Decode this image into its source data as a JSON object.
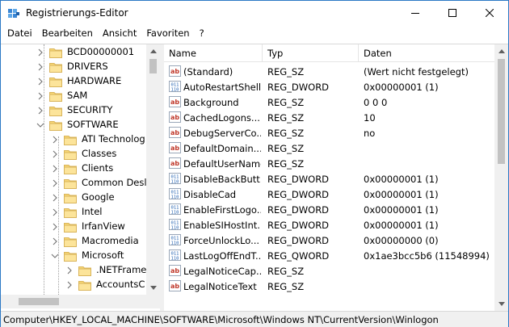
{
  "window": {
    "title": "Registrierungs-Editor",
    "accent": "#2b78c5"
  },
  "menu": [
    {
      "label": "Datei"
    },
    {
      "label": "Bearbeiten"
    },
    {
      "label": "Ansicht"
    },
    {
      "label": "Favoriten"
    },
    {
      "label": "?"
    }
  ],
  "tree": {
    "items": [
      {
        "label": "BCD00000001",
        "level": 1,
        "expanded": false
      },
      {
        "label": "DRIVERS",
        "level": 1,
        "expanded": false
      },
      {
        "label": "HARDWARE",
        "level": 1,
        "expanded": false
      },
      {
        "label": "SAM",
        "level": 1,
        "expanded": false
      },
      {
        "label": "SECURITY",
        "level": 1,
        "expanded": false
      },
      {
        "label": "SOFTWARE",
        "level": 1,
        "expanded": true
      },
      {
        "label": "ATI Technolog",
        "level": 2,
        "expanded": false
      },
      {
        "label": "Classes",
        "level": 2,
        "expanded": false
      },
      {
        "label": "Clients",
        "level": 2,
        "expanded": false
      },
      {
        "label": "Common Desl",
        "level": 2,
        "expanded": false
      },
      {
        "label": "Google",
        "level": 2,
        "expanded": false
      },
      {
        "label": "Intel",
        "level": 2,
        "expanded": false
      },
      {
        "label": "IrfanView",
        "level": 2,
        "expanded": false
      },
      {
        "label": "Macromedia",
        "level": 2,
        "expanded": false
      },
      {
        "label": "Microsoft",
        "level": 2,
        "expanded": true
      },
      {
        "label": ".NETFrame",
        "level": 3,
        "expanded": false
      },
      {
        "label": "AccountsC",
        "level": 3,
        "expanded": false
      }
    ]
  },
  "list": {
    "columns": {
      "name": "Name",
      "type": "Typ",
      "data": "Daten"
    },
    "rows": [
      {
        "icon": "string",
        "name": "(Standard)",
        "type": "REG_SZ",
        "data": "(Wert nicht festgelegt)"
      },
      {
        "icon": "binary",
        "name": "AutoRestartShell",
        "type": "REG_DWORD",
        "data": "0x00000001 (1)"
      },
      {
        "icon": "string",
        "name": "Background",
        "type": "REG_SZ",
        "data": "0 0 0"
      },
      {
        "icon": "string",
        "name": "CachedLogons...",
        "type": "REG_SZ",
        "data": "10"
      },
      {
        "icon": "string",
        "name": "DebugServerCo...",
        "type": "REG_SZ",
        "data": "no"
      },
      {
        "icon": "string",
        "name": "DefaultDomain...",
        "type": "REG_SZ",
        "data": ""
      },
      {
        "icon": "string",
        "name": "DefaultUserName",
        "type": "REG_SZ",
        "data": ""
      },
      {
        "icon": "binary",
        "name": "DisableBackButt...",
        "type": "REG_DWORD",
        "data": "0x00000001 (1)"
      },
      {
        "icon": "binary",
        "name": "DisableCad",
        "type": "REG_DWORD",
        "data": "0x00000001 (1)"
      },
      {
        "icon": "binary",
        "name": "EnableFirstLogo...",
        "type": "REG_DWORD",
        "data": "0x00000001 (1)"
      },
      {
        "icon": "binary",
        "name": "EnableSIHostInt...",
        "type": "REG_DWORD",
        "data": "0x00000001 (1)"
      },
      {
        "icon": "binary",
        "name": "ForceUnlockLo...",
        "type": "REG_DWORD",
        "data": "0x00000000 (0)"
      },
      {
        "icon": "binary",
        "name": "LastLogOffEndT...",
        "type": "REG_QWORD",
        "data": "0x1ae3bcc5b6 (11548994)"
      },
      {
        "icon": "string",
        "name": "LegalNoticeCap...",
        "type": "REG_SZ",
        "data": ""
      },
      {
        "icon": "string",
        "name": "LegalNoticeText",
        "type": "REG_SZ",
        "data": ""
      }
    ]
  },
  "statusbar": {
    "path": "Computer\\HKEY_LOCAL_MACHINE\\SOFTWARE\\Microsoft\\Windows NT\\CurrentVersion\\Winlogon"
  }
}
